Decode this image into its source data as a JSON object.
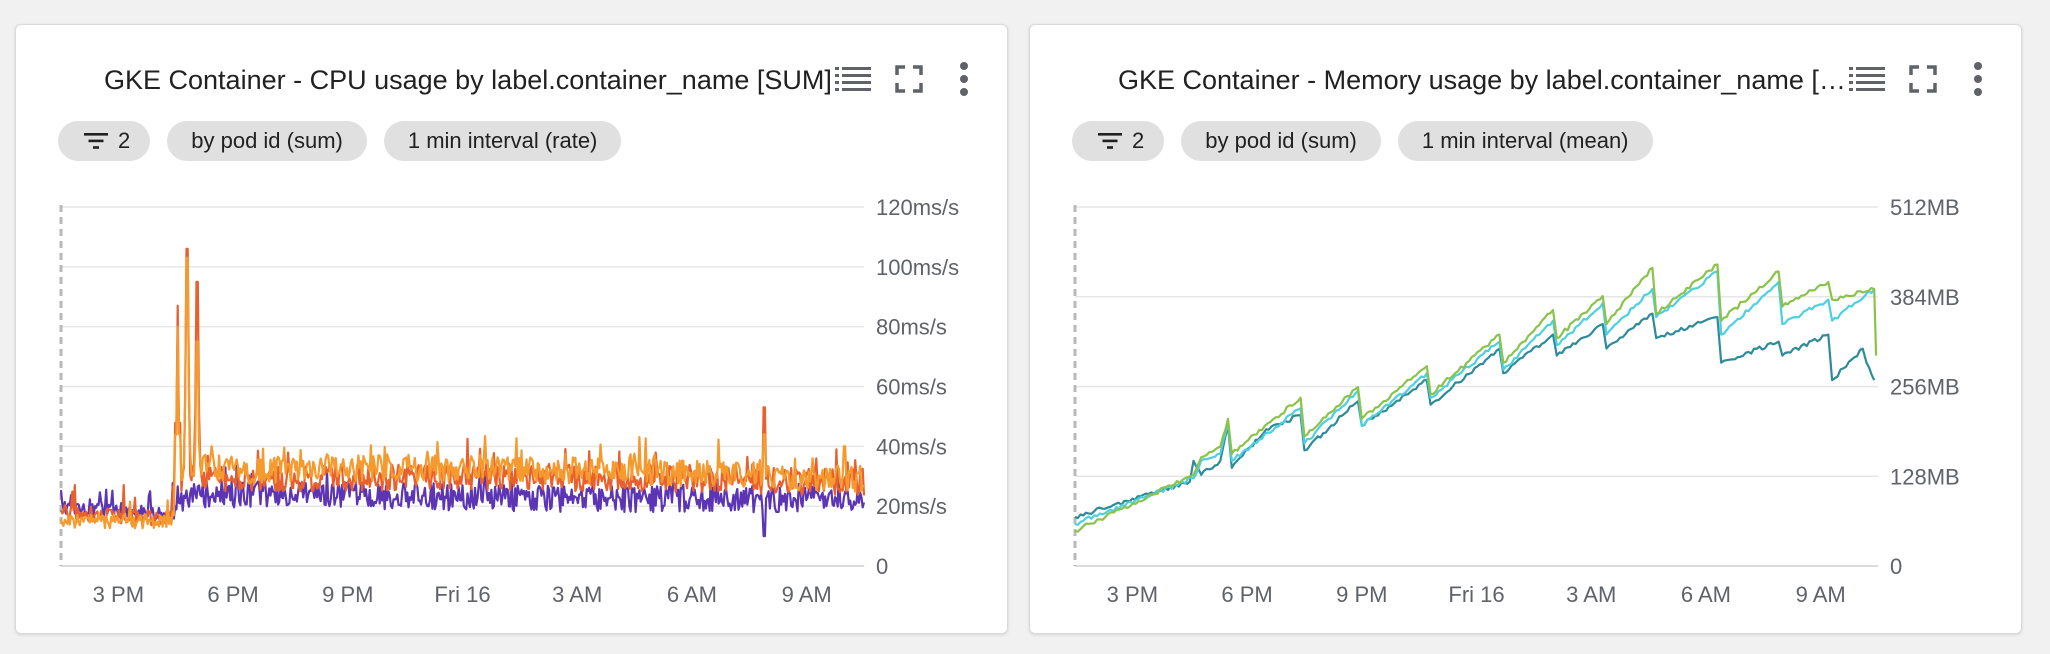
{
  "colors": {
    "cpu_orange": "#f49a2e",
    "cpu_red": "#e8602e",
    "cpu_purple": "#5c35b5",
    "mem_green": "#8bc34a",
    "mem_cyan": "#4dd0e1",
    "mem_teal": "#2e8b9a",
    "grid": "#e6e6e6",
    "icon": "#5f6368"
  },
  "icons": {
    "list": "view-list-icon",
    "fullscreen": "fullscreen-icon",
    "more": "more-vert-icon",
    "filter": "filter-list-icon"
  },
  "cards": [
    {
      "title": "GKE Container - CPU usage by label.container_name [SUM]",
      "chips": {
        "filter_count": "2",
        "group": "by pod id (sum)",
        "interval": "1 min interval (rate)"
      }
    },
    {
      "title": "GKE Container - Memory usage by label.container_name [SUM]",
      "chips": {
        "filter_count": "2",
        "group": "by pod id (sum)",
        "interval": "1 min interval (mean)"
      }
    }
  ],
  "chart_data": [
    {
      "type": "line",
      "title": "GKE Container - CPU usage by label.container_name [SUM]",
      "x_ticks": [
        "3 PM",
        "6 PM",
        "9 PM",
        "Fri 16",
        "3 AM",
        "6 AM",
        "9 AM"
      ],
      "x_tick_hours": [
        15,
        18,
        21,
        24,
        27,
        30,
        33
      ],
      "xlim_hours": [
        13.5,
        34.5
      ],
      "y_ticks": [
        "0",
        "20ms/s",
        "40ms/s",
        "60ms/s",
        "80ms/s",
        "100ms/s",
        "120ms/s"
      ],
      "ylim": [
        0,
        120
      ],
      "y_unit": "ms/s",
      "grid": true,
      "series": [
        {
          "color": "#5c35b5",
          "base": [
            [
              13.5,
              20
            ],
            [
              16,
              18
            ],
            [
              16.4,
              17
            ],
            [
              16.6,
              20
            ],
            [
              17,
              24
            ],
            [
              18,
              24
            ],
            [
              24,
              23
            ],
            [
              30,
              22
            ],
            [
              34.5,
              22
            ]
          ],
          "spikes": [
            [
              31.9,
              10
            ]
          ]
        },
        {
          "color": "#e8602e",
          "base": [
            [
              13.5,
              18
            ],
            [
              16,
              16
            ],
            [
              16.4,
              16
            ],
            [
              16.6,
              28
            ],
            [
              17,
              30
            ],
            [
              18,
              29
            ],
            [
              24,
              30
            ],
            [
              30,
              29
            ],
            [
              34.5,
              28
            ]
          ],
          "spikes": [
            [
              16.55,
              87
            ],
            [
              16.8,
              106
            ],
            [
              17.05,
              95
            ],
            [
              31.9,
              53
            ]
          ]
        },
        {
          "color": "#f49a2e",
          "base": [
            [
              13.5,
              15
            ],
            [
              16,
              15
            ],
            [
              16.4,
              15
            ],
            [
              16.6,
              30
            ],
            [
              17,
              34
            ],
            [
              18,
              32
            ],
            [
              24,
              33
            ],
            [
              30,
              31
            ],
            [
              34.5,
              29
            ]
          ],
          "spikes": [
            [
              16.55,
              80
            ],
            [
              16.8,
              103
            ],
            [
              17.05,
              75
            ],
            [
              31.9,
              44
            ],
            [
              34,
              40
            ]
          ]
        }
      ]
    },
    {
      "type": "line",
      "title": "GKE Container - Memory usage by label.container_name [SUM]",
      "x_ticks": [
        "3 PM",
        "6 PM",
        "9 PM",
        "Fri 16",
        "3 AM",
        "6 AM",
        "9 AM"
      ],
      "x_tick_hours": [
        15,
        18,
        21,
        24,
        27,
        30,
        33
      ],
      "xlim_hours": [
        13.5,
        34.5
      ],
      "y_ticks": [
        "0",
        "128MB",
        "256MB",
        "384MB",
        "512MB"
      ],
      "ylim": [
        0,
        512
      ],
      "y_unit": "MB",
      "grid": true,
      "series": [
        {
          "color": "#2e8b9a",
          "points": [
            [
              13.5,
              70
            ],
            [
              16.5,
              120
            ],
            [
              16.6,
              150
            ],
            [
              16.8,
              130
            ],
            [
              17.3,
              150
            ],
            [
              17.5,
              200
            ],
            [
              17.6,
              140
            ],
            [
              18.5,
              195
            ],
            [
              19.4,
              215
            ],
            [
              19.5,
              165
            ],
            [
              20.9,
              235
            ],
            [
              21,
              200
            ],
            [
              22.7,
              265
            ],
            [
              22.8,
              230
            ],
            [
              24.6,
              310
            ],
            [
              24.7,
              275
            ],
            [
              26,
              330
            ],
            [
              26.1,
              300
            ],
            [
              27.3,
              345
            ],
            [
              27.4,
              310
            ],
            [
              28.6,
              360
            ],
            [
              28.7,
              325
            ],
            [
              30.3,
              355
            ],
            [
              30.4,
              290
            ],
            [
              31.9,
              320
            ],
            [
              32,
              300
            ],
            [
              33.2,
              330
            ],
            [
              33.3,
              265
            ],
            [
              34.1,
              310
            ],
            [
              34.2,
              290
            ],
            [
              34.4,
              265
            ]
          ]
        },
        {
          "color": "#4dd0e1",
          "points": [
            [
              13.5,
              60
            ],
            [
              16.6,
              125
            ],
            [
              16.8,
              150
            ],
            [
              17.3,
              160
            ],
            [
              17.5,
              205
            ],
            [
              17.6,
              150
            ],
            [
              19.4,
              225
            ],
            [
              19.5,
              175
            ],
            [
              20.9,
              250
            ],
            [
              21,
              200
            ],
            [
              22.7,
              275
            ],
            [
              22.8,
              240
            ],
            [
              24.6,
              320
            ],
            [
              24.7,
              280
            ],
            [
              26,
              350
            ],
            [
              26.1,
              315
            ],
            [
              27.3,
              375
            ],
            [
              27.4,
              330
            ],
            [
              28.6,
              395
            ],
            [
              28.7,
              355
            ],
            [
              30.3,
              420
            ],
            [
              30.4,
              330
            ],
            [
              31.9,
              405
            ],
            [
              32,
              345
            ],
            [
              33.2,
              380
            ],
            [
              33.3,
              350
            ],
            [
              34.4,
              395
            ]
          ]
        },
        {
          "color": "#8bc34a",
          "points": [
            [
              13.5,
              50
            ],
            [
              16.6,
              130
            ],
            [
              16.8,
              155
            ],
            [
              17.3,
              170
            ],
            [
              17.5,
              210
            ],
            [
              17.6,
              160
            ],
            [
              19.4,
              240
            ],
            [
              19.5,
              185
            ],
            [
              20.9,
              255
            ],
            [
              21,
              210
            ],
            [
              22.7,
              285
            ],
            [
              22.8,
              245
            ],
            [
              24.6,
              330
            ],
            [
              24.7,
              290
            ],
            [
              26,
              365
            ],
            [
              26.1,
              325
            ],
            [
              27.3,
              385
            ],
            [
              27.4,
              345
            ],
            [
              28.6,
              425
            ],
            [
              28.7,
              360
            ],
            [
              30.3,
              430
            ],
            [
              30.4,
              350
            ],
            [
              31.9,
              420
            ],
            [
              32,
              370
            ],
            [
              33.2,
              405
            ],
            [
              33.3,
              380
            ],
            [
              34.4,
              395
            ],
            [
              34.45,
              300
            ]
          ]
        }
      ]
    }
  ]
}
